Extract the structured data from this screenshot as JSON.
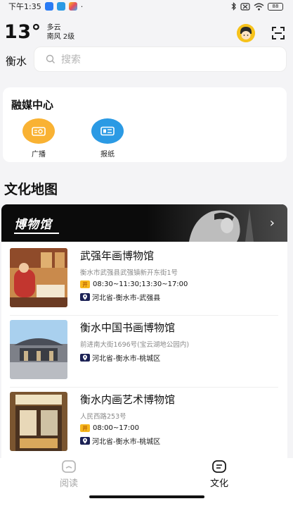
{
  "status_bar": {
    "time": "下午1:35",
    "battery": "88",
    "dot": "·"
  },
  "weather": {
    "temperature": "13°",
    "condition": "多云",
    "wind": "南风 2级"
  },
  "header": {
    "city": "衡水",
    "search_placeholder": "搜索"
  },
  "media_center": {
    "title": "融媒中心",
    "items": [
      {
        "label": "广播",
        "icon": "radio-icon",
        "color": "#f9b233"
      },
      {
        "label": "报纸",
        "icon": "newspaper-icon",
        "color": "#2b9ae4"
      }
    ]
  },
  "culture_map": {
    "title": "文化地图",
    "banner_title": "博物馆",
    "museums": [
      {
        "name": "武强年画博物馆",
        "address": "衡水市武强县武强镇新开东街1号",
        "hours": "08:30~11:30;13:30~17:00",
        "region": "河北省-衡水市-武强县"
      },
      {
        "name": "衡水中国书画博物馆",
        "address": "前进南大街1696号(宝云湖地公园内)",
        "hours": "",
        "region": "河北省-衡水市-桃城区"
      },
      {
        "name": "衡水内画艺术博物馆",
        "address": "人民西路253号",
        "hours": "08:00~17:00",
        "region": "河北省-衡水市-桃城区"
      }
    ]
  },
  "bottom_nav": {
    "items": [
      {
        "label": "阅读",
        "icon": "read-icon",
        "active": false
      },
      {
        "label": "文化",
        "icon": "culture-icon",
        "active": true
      }
    ]
  },
  "colors": {
    "accent_orange": "#f9b233",
    "accent_blue": "#2b9ae4",
    "banner_bg": "#0b0b0b",
    "region_badge": "#1c2255"
  }
}
